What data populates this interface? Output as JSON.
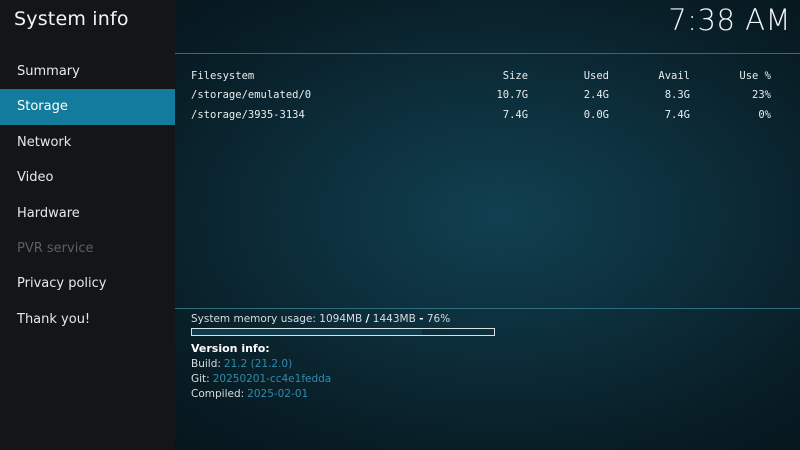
{
  "app": {
    "title": "System info",
    "clock": "7:38 AM"
  },
  "sidebar": {
    "items": [
      {
        "label": "Summary",
        "state": "normal"
      },
      {
        "label": "Storage",
        "state": "active"
      },
      {
        "label": "Network",
        "state": "normal"
      },
      {
        "label": "Video",
        "state": "normal"
      },
      {
        "label": "Hardware",
        "state": "normal"
      },
      {
        "label": "PVR service",
        "state": "disabled"
      },
      {
        "label": "Privacy policy",
        "state": "normal"
      },
      {
        "label": "Thank you!",
        "state": "normal"
      }
    ]
  },
  "storage": {
    "headers": {
      "filesystem": "Filesystem",
      "size": "Size",
      "used": "Used",
      "avail": "Avail",
      "use": "Use %"
    },
    "rows": [
      {
        "filesystem": "/storage/emulated/0",
        "size": "10.7G",
        "used": "2.4G",
        "avail": "8.3G",
        "use": "23%"
      },
      {
        "filesystem": "/storage/3935-3134",
        "size": "7.4G",
        "used": "0.0G",
        "avail": "7.4G",
        "use": "0%"
      }
    ]
  },
  "memory": {
    "label": "System memory usage:",
    "used": "1094MB",
    "sep": "/",
    "total": "1443MB",
    "dash": "-",
    "percent_text": "76%",
    "percent": 76
  },
  "version": {
    "title": "Version info:",
    "build_label": "Build:",
    "build_value": "21.2 (21.2.0)",
    "git_label": "Git:",
    "git_value": "20250201-cc4e1fedda",
    "compiled_label": "Compiled:",
    "compiled_value": "2025-02-01"
  },
  "colors": {
    "accent": "#137b9c",
    "sidebar_bg": "#141516",
    "link_blue": "#2d8cb0",
    "disabled": "#5b5f61"
  }
}
